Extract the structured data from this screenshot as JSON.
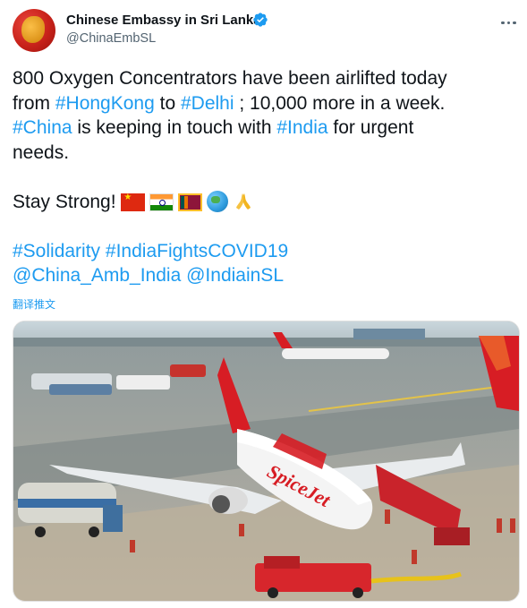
{
  "account": {
    "name": "Chinese Embassy in Sri Lanka",
    "handle": "@ChinaEmbSL",
    "verified_icon": "verified-badge-icon",
    "avatar_icon": "embassy-avatar",
    "more_icon": "more-options-icon"
  },
  "tweet": {
    "line1_text": "800 Oxygen Concentrators have been airlifted today",
    "line2_prefix": "from ",
    "tag_hongkong": "#HongKong",
    "to": " to ",
    "tag_delhi": "#Delhi",
    "line2_suffix": " ; 10,000 more in a week.",
    "tag_china": "#China",
    "line3_mid": " is keeping in touch with ",
    "tag_india": "#India",
    "line3_end": " for urgent",
    "line4": "needs.",
    "stay_strong": "Stay Strong! ",
    "emojis": [
      "flag-china",
      "flag-india",
      "flag-sri-lanka",
      "globe",
      "folded-hands"
    ],
    "tag_solidarity": "#Solidarity",
    "tag_indiafights": "#IndiaFightsCOVID19",
    "mention_china_amb": "@China_Amb_India",
    "mention_indiain": "@IndiainSL"
  },
  "translate_label": "翻译推文",
  "media": {
    "description_icon": "airport-photo",
    "plane_livery": "SpiceJet",
    "accent_color": "#1d9bf0",
    "brand_red": "#d71d24"
  }
}
